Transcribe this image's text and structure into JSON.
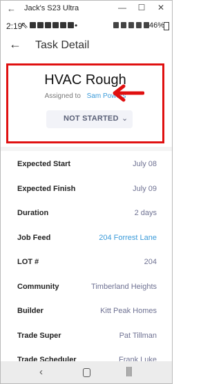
{
  "window": {
    "title": "Jack's S23 Ultra",
    "back_icon": "←",
    "minimize_icon": "—",
    "maximize_icon": "☐",
    "close_icon": "✕"
  },
  "status_bar": {
    "time": "2:19",
    "battery": "46%"
  },
  "app_bar": {
    "title": "Task Detail",
    "back_icon": "←"
  },
  "task": {
    "name": "HVAC Rough",
    "assigned_label": "Assigned to",
    "assignee": "Sam Powers",
    "status": "NOT STARTED",
    "status_chevron": "⌄"
  },
  "details": [
    {
      "label": "Expected Start",
      "value": "July 08",
      "style": "muted"
    },
    {
      "label": "Expected Finish",
      "value": "July 09",
      "style": "muted"
    },
    {
      "label": "Duration",
      "value": "2 days",
      "style": "muted"
    },
    {
      "label": "Job Feed",
      "value": "204 Forrest Lane",
      "style": "link"
    },
    {
      "label": "LOT #",
      "value": "204",
      "style": "muted"
    },
    {
      "label": "Community",
      "value": "Timberland Heights",
      "style": "muted"
    },
    {
      "label": "Builder",
      "value": "Kitt Peak Homes",
      "style": "muted"
    },
    {
      "label": "Trade Super",
      "value": "Pat Tillman",
      "style": "muted"
    },
    {
      "label": "Trade Scheduler",
      "value": "Frank Luke",
      "style": "muted"
    }
  ],
  "nav": {
    "back": "‹",
    "home": "",
    "recents": "|||"
  },
  "colors": {
    "highlight": "#e01010",
    "link": "#3a9ad9",
    "status_text": "#5b6178"
  }
}
